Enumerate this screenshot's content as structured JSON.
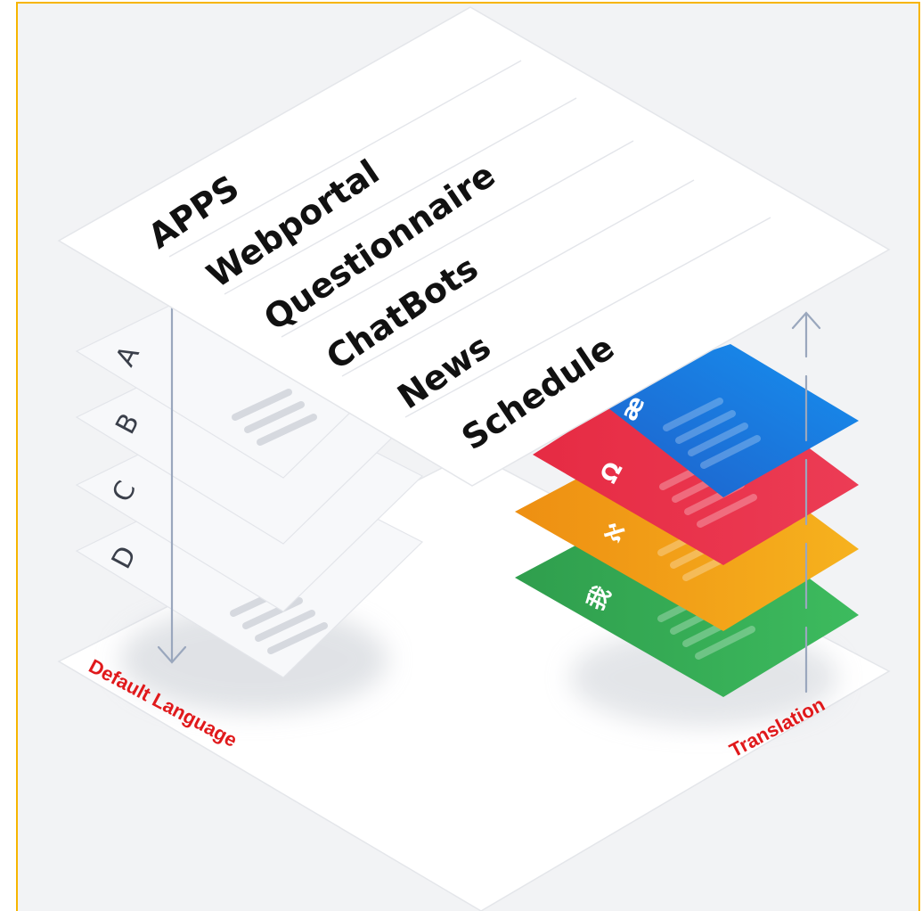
{
  "menu": {
    "items": [
      "APPS",
      "Webportal",
      "Questionnaire",
      "ChatBots",
      "News",
      "Schedule"
    ]
  },
  "default_language": {
    "label": "Default Language",
    "layers": [
      "A",
      "B",
      "C",
      "D"
    ]
  },
  "translation": {
    "label": "Translation",
    "layers": [
      {
        "glyph": "æ",
        "color": "#1e73e6"
      },
      {
        "glyph": "Ω",
        "color": "#e8344a"
      },
      {
        "glyph": "ℵ",
        "color": "#f0a218"
      },
      {
        "glyph": "我",
        "color": "#34a853"
      }
    ]
  },
  "colors": {
    "frame_border": "#f7b500",
    "label_red": "#e0191b",
    "arrow": "#9aa7bd"
  }
}
